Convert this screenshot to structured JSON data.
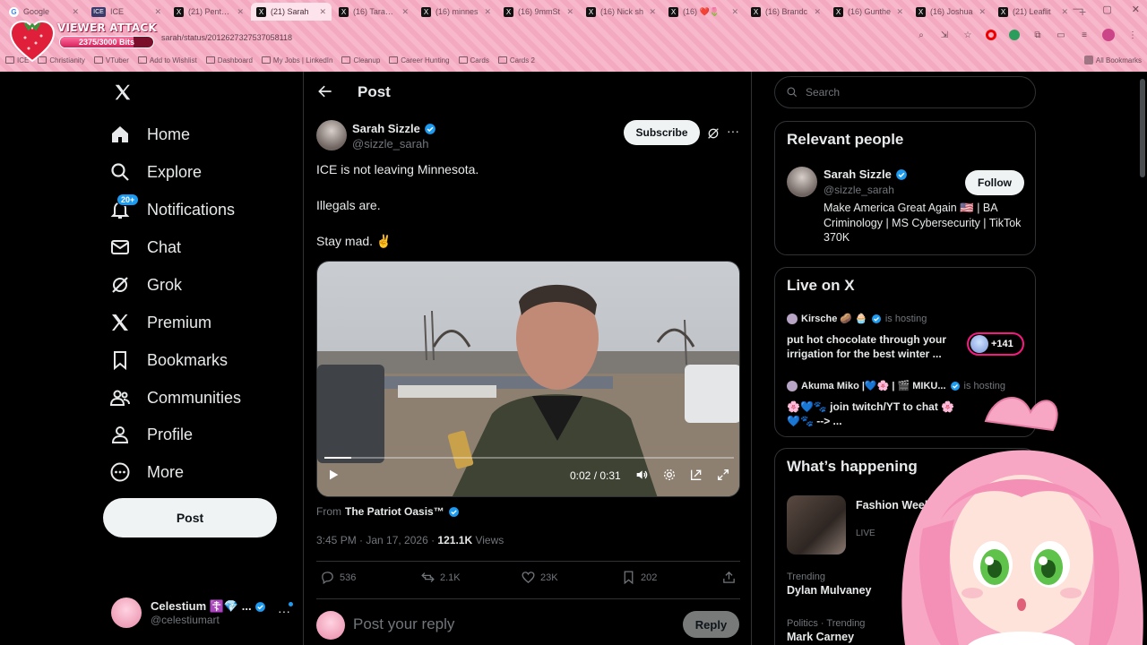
{
  "browser": {
    "tabs": [
      {
        "label": "Google",
        "fav": "G"
      },
      {
        "label": "ICE",
        "fav": "ICE"
      },
      {
        "label": "(21) Pentago",
        "fav": "X"
      },
      {
        "label": "(21) Sarah",
        "fav": "X",
        "active": true
      },
      {
        "label": "(16) TaraBull",
        "fav": "X"
      },
      {
        "label": "(16) minnes",
        "fav": "X"
      },
      {
        "label": "(16) 9mmSt",
        "fav": "X"
      },
      {
        "label": "(16) Nick sh",
        "fav": "X"
      },
      {
        "label": "(16) ❤️🌷",
        "fav": "X"
      },
      {
        "label": "(16) Brandc",
        "fav": "X"
      },
      {
        "label": "(16) Gunthe",
        "fav": "X"
      },
      {
        "label": "(16) Joshua",
        "fav": "X"
      },
      {
        "label": "(21) Leaflit",
        "fav": "X"
      }
    ],
    "url": "sarah/status/2012627327537058118",
    "bookmarks": [
      "ICE",
      "Christianity",
      "VTuber",
      "Add to Wishlist",
      "Dashboard",
      "My Jobs | LinkedIn",
      "Cleanup",
      "Career Hunting",
      "Cards",
      "Cards 2"
    ],
    "all_bookmarks": "All Bookmarks",
    "colors": {
      "chrome_pink": "#f7b8cc"
    }
  },
  "overlay": {
    "title": "VIEWER ATTACK",
    "progress_text": "2375/3000 Bits",
    "progress": 0.7917
  },
  "nav": {
    "items": [
      {
        "label": "Home",
        "icon": "home-icon"
      },
      {
        "label": "Explore",
        "icon": "search-icon"
      },
      {
        "label": "Notifications",
        "icon": "bell-icon"
      },
      {
        "label": "Chat",
        "icon": "mail-icon"
      },
      {
        "label": "Grok",
        "icon": "grok-icon"
      },
      {
        "label": "Premium",
        "icon": "x-icon"
      },
      {
        "label": "Bookmarks",
        "icon": "bookmark-icon"
      },
      {
        "label": "Communities",
        "icon": "people-icon"
      },
      {
        "label": "Profile",
        "icon": "person-icon"
      },
      {
        "label": "More",
        "icon": "more-circle-icon"
      }
    ],
    "notif_badge": "20+",
    "post_label": "Post",
    "account": {
      "name": "Celestium ☦️💎 ...",
      "handle": "@celestiumart"
    }
  },
  "post": {
    "header": "Post",
    "author": {
      "name": "Sarah Sizzle",
      "handle": "@sizzle_sarah"
    },
    "subscribe_label": "Subscribe",
    "lines": [
      "ICE is not leaving Minnesota.",
      "Illegals are.",
      "Stay mad. ✌️"
    ],
    "video": {
      "time": "0:02 / 0:31",
      "progress": 0.065
    },
    "from_label": "From",
    "from_source": "The Patriot Oasis™",
    "time": "3:45 PM · Jan 17, 2026 · ",
    "views_count": "121.1K",
    "views_label": " Views",
    "stats": {
      "replies": "536",
      "reposts": "2.1K",
      "likes": "23K",
      "bookmarks": "202"
    },
    "reply_placeholder": "Post your reply",
    "reply_button": "Reply"
  },
  "right": {
    "search_placeholder": "Search",
    "relevant": {
      "title": "Relevant people",
      "name": "Sarah Sizzle",
      "handle": "@sizzle_sarah",
      "follow_label": "Follow",
      "bio": "Make America Great Again 🇺🇸 | BA Criminology | MS Cybersecurity | TikTok 370K"
    },
    "live": {
      "title": "Live on X",
      "items": [
        {
          "host": "Kirsche 🥔 🧁",
          "hosting": "is hosting",
          "title": "put hot chocolate through your irrigation for the best winter ...",
          "count": "+141"
        },
        {
          "host": "Akuma Miko |💙🌸 | 🎬 MIKU...",
          "hosting": "is hosting",
          "title": "🌸💙🐾 join twitch/YT to chat 🌸💙🐾 --> ..."
        }
      ]
    },
    "happening": {
      "title": "What’s happening",
      "news_title": "Fashion Week FW26 & Ha",
      "news_sub": "LIVE",
      "trends": [
        {
          "category": "Trending",
          "title": "Dylan Mulvaney"
        },
        {
          "category": "Politics · Trending",
          "title": "Mark Carney"
        }
      ]
    }
  }
}
